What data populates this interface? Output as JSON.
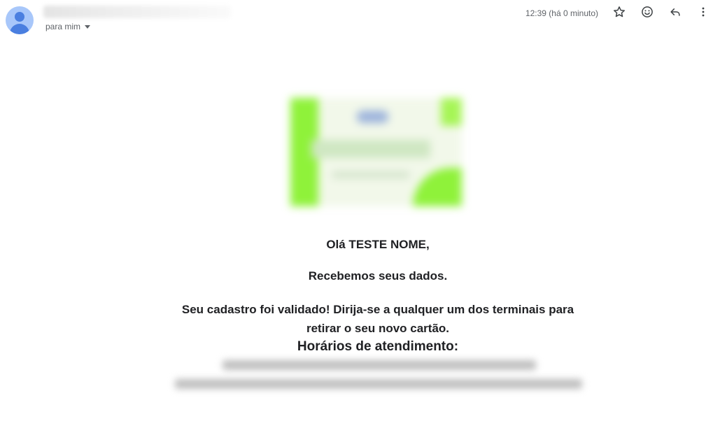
{
  "header": {
    "recipient_label": "para mim",
    "timestamp": "12:39 (há 0 minuto)",
    "icons": [
      "star-icon",
      "emoji-icon",
      "reply-icon",
      "more-vert-icon"
    ]
  },
  "email": {
    "greeting": "Olá TESTE NOME,",
    "received": "Recebemos seus dados.",
    "validated": "Seu cadastro foi validado! Dirija-se a qualquer um dos terminais para retirar o seu novo cartão.",
    "hours_title": "Horários de atendimento:"
  },
  "colors": {
    "avatar_bg": "#a8c7fa",
    "avatar_fg": "#4a7fe0",
    "secondary_text": "#5f6368",
    "brand_green": "#8ff23a"
  }
}
